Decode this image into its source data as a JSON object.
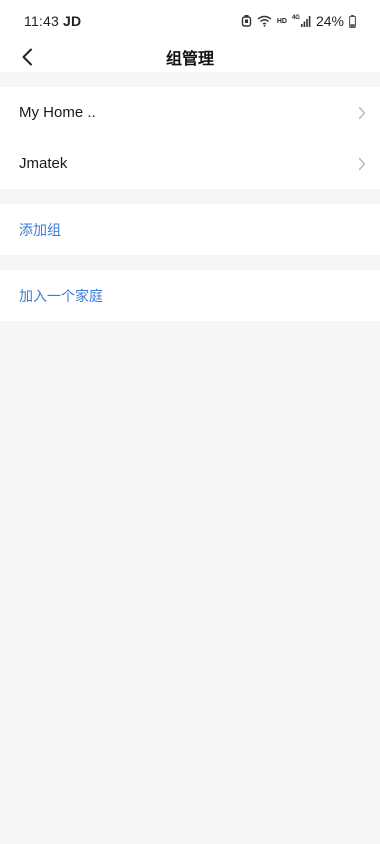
{
  "status_bar": {
    "time": "11:43",
    "carrier": "JD",
    "network": "4G",
    "hd_label": "HD",
    "battery": "24%"
  },
  "header": {
    "title": "组管理"
  },
  "groups": {
    "items": [
      {
        "label": "My Home .."
      },
      {
        "label": "Jmatek"
      }
    ]
  },
  "actions": {
    "add_group": "添加组",
    "join_home": "加入一个家庭"
  },
  "colors": {
    "accent": "#3b7bd6",
    "background": "#f6f6f6",
    "card": "#ffffff"
  }
}
